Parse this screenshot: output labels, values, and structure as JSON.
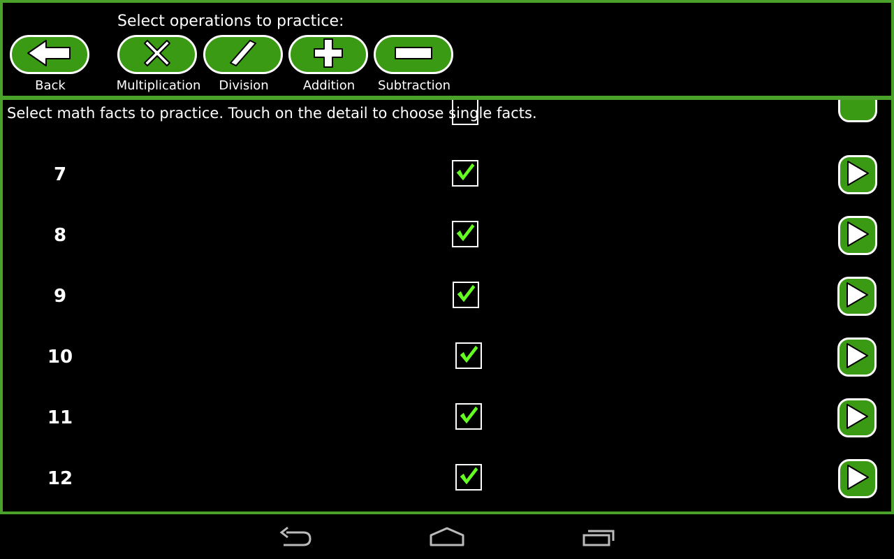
{
  "header": {
    "ops_title": "Select operations to practice:",
    "back_label": "Back",
    "operations": [
      {
        "label": "Multiplication",
        "icon": "multiply-icon"
      },
      {
        "label": "Division",
        "icon": "divide-slash-icon"
      },
      {
        "label": "Addition",
        "icon": "plus-icon"
      },
      {
        "label": "Subtraction",
        "icon": "minus-icon"
      }
    ]
  },
  "main": {
    "instructions": "Select math facts to practice. Touch on the detail to choose single facts.",
    "rows": [
      {
        "number": "7",
        "checked": true
      },
      {
        "number": "8",
        "checked": true
      },
      {
        "number": "9",
        "checked": true
      },
      {
        "number": "10",
        "checked": true
      },
      {
        "number": "11",
        "checked": true
      },
      {
        "number": "12",
        "checked": true
      }
    ]
  },
  "colors": {
    "accent": "#3a9a14",
    "border": "#4aa22a",
    "check": "#66ff22"
  }
}
